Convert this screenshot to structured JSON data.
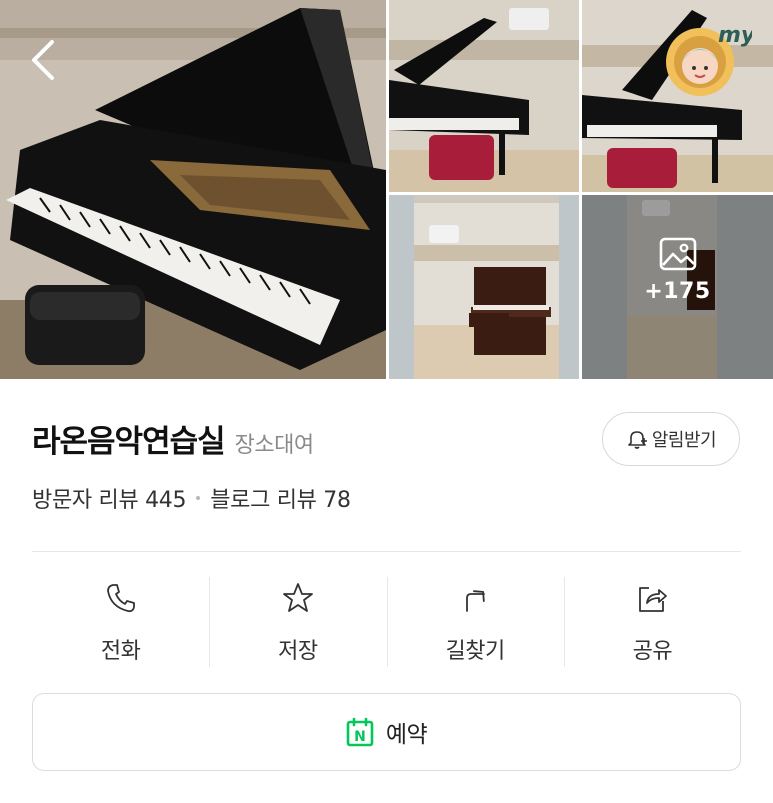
{
  "gallery": {
    "more_count": "+175",
    "badge_text": "my"
  },
  "place": {
    "name": "라온음악연습실",
    "category": "장소대여",
    "notify_label": "알림받기"
  },
  "reviews": {
    "visitor_label": "방문자 리뷰 445",
    "blog_label": "블로그 리뷰 78"
  },
  "actions": [
    {
      "label": "전화",
      "icon": "phone-icon"
    },
    {
      "label": "저장",
      "icon": "star-icon"
    },
    {
      "label": "길찾기",
      "icon": "directions-icon"
    },
    {
      "label": "공유",
      "icon": "share-icon"
    }
  ],
  "reserve": {
    "label": "예약",
    "icon": "naver-calendar-icon",
    "icon_letter": "N",
    "accent": "#03c75a"
  }
}
